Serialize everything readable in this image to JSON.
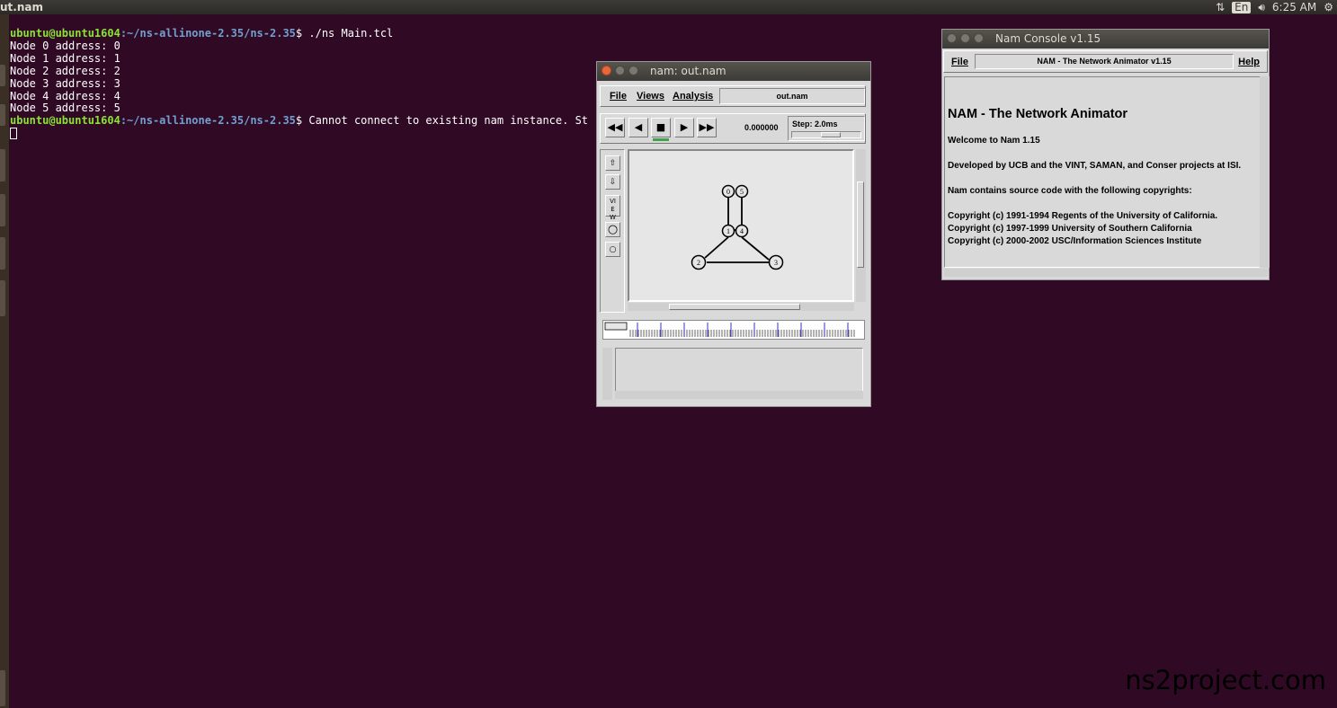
{
  "topbar": {
    "app_title": "ut.nam",
    "keyboard": "En",
    "time": "6:25 AM"
  },
  "terminal": {
    "prompt_user": "ubuntu@ubuntu1604",
    "prompt_path": ":~/ns-allinone-2.35/ns-2.35",
    "prompt_symbol": "$",
    "command1": " ./ns Main.tcl",
    "output": [
      "Node 0 address: 0",
      "Node 1 address: 1",
      "Node 2 address: 2",
      "Node 3 address: 3",
      "Node 4 address: 4",
      "Node 5 address: 5"
    ],
    "command2": " Cannot connect to existing nam instance. St"
  },
  "nam_window": {
    "title": "nam: out.nam",
    "menu": [
      "File",
      "Views",
      "Analysis"
    ],
    "file_label": "out.nam",
    "controls": {
      "rewind": "◀◀",
      "back": "◀",
      "stop": "■",
      "play": "▶",
      "ffwd": "▶▶"
    },
    "time_value": "0.000000",
    "step_label": "Step: 2.0ms",
    "tools": {
      "zoom_in": "⇧",
      "zoom_out": "⇩",
      "view": "VIEW",
      "big_node": "○",
      "small_node": "○"
    },
    "nodes": [
      "0",
      "1",
      "2",
      "3",
      "4",
      "5"
    ]
  },
  "console": {
    "title": "Nam Console v1.15",
    "menu_file": "File",
    "menu_help": "Help",
    "header_label": "NAM - The Network Animator v1.15",
    "heading": "NAM - The Network Animator",
    "lines": [
      "Welcome to Nam 1.15",
      "Developed by UCB and the VINT, SAMAN, and Conser projects at ISI.",
      "Nam contains source code with the following copyrights:",
      "Copyright (c) 1991-1994 Regents of the University of California.",
      "Copyright (c) 1997-1999 University of Southern California",
      "Copyright (c) 2000-2002 USC/Information Sciences Institute"
    ]
  },
  "watermark": "ns2project.com"
}
